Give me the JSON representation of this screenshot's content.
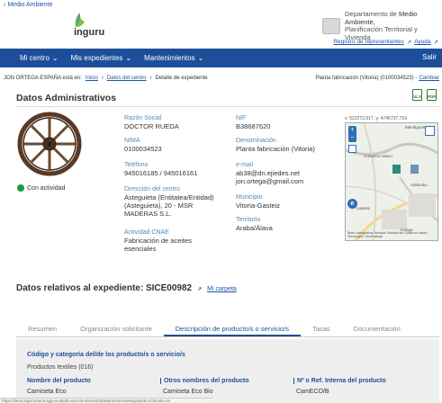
{
  "header": {
    "back_label": "Medio Ambiente",
    "logo_text": "inguru",
    "dept_prefix": "Departamento de ",
    "dept_strong": "Medio Ambiente,",
    "dept_line2": "Planificación Territorial y Vivienda",
    "registro_label": "Registro de representantes",
    "ayuda_label": "Ayuda"
  },
  "nav": {
    "items": [
      "Mi centro",
      "Mis expedientes",
      "Mantenimientos"
    ],
    "exit_label": "Salir"
  },
  "breadcrumb": {
    "user_text": "JON ORTEGA ESPAÑA está en:",
    "inicio": "Inicio",
    "datos_centro": "Datos del centro",
    "current": "Detalle de expediente",
    "right_text": "Planta fabricación (Vitoria) (0100034523) -",
    "right_link": "Cambiar"
  },
  "admin": {
    "title": "Datos Administrativos",
    "status_label": "Con actividad",
    "razon_social": {
      "label": "Razón Social",
      "value": "DOCTOR RUEDA"
    },
    "nif": {
      "label": "NIF",
      "value": "B38687620"
    },
    "nima": {
      "label": "NIMA",
      "value": "0100034523"
    },
    "denominacion": {
      "label": "Denominación",
      "value": "Planta fabricación (Vitoria)"
    },
    "telefono": {
      "label": "Teléfono",
      "value": "945016185 / 945016161"
    },
    "email": {
      "label": "e-mail",
      "value1": "ab38@dn.ejiedes.net",
      "value2": "jon.ortega@gmail.com"
    },
    "direccion": {
      "label": "Dirección del centro",
      "line1": "Asteguieta (Entitatea/Entidad)",
      "line2": "(Asteguieta), 20 - MSR",
      "line3": "MADERAS S.L."
    },
    "municipio": {
      "label": "Municipio",
      "value": "Vitoria-Gasteiz"
    },
    "territorio": {
      "label": "Territorio",
      "value": "Araba/Álava"
    },
    "cnae": {
      "label": "Actividad CNAE",
      "line1": "Fabricación de aceites",
      "line2": "esenciales"
    }
  },
  "map": {
    "coords": "x: 522272.017, y: 4745737.719",
    "label_top": "Mendiguren",
    "label_mid": "Gobierno Vasco",
    "label_b1": "Abetxuko",
    "label_b2": "Lasarte",
    "label_b3": "Arriaga",
    "footer": "Base cartográfica: Idealatx, Bizkaia del Gobierno Vasco, Tecnología: GeoEuskadi"
  },
  "expediente": {
    "title": "Datos relativos al expediente: SICE00982",
    "carpeta_label": "Mi carpeta"
  },
  "tabs": [
    "Resumen",
    "Organización solicitante",
    "Descripción de producto/s o servicio/s",
    "Tasas",
    "Documentación"
  ],
  "products": {
    "heading": "Código y categoría del/de los producto/s o servicio/s",
    "subheading": "Productos textiles (016)",
    "columns": [
      "Nombre del producto",
      "Otros nombres del producto",
      "Nº o Ref. Interna del producto"
    ],
    "rows": [
      [
        "Camiseta Eco",
        "Camiseta Eco Bio",
        "CamECO/B"
      ]
    ]
  },
  "statusbar_text": "https://desa.ingurumena.ejgv.euskadi.eus/r49-sia/es/t28aWar/sistemaIntegradoEco?locale=es"
}
